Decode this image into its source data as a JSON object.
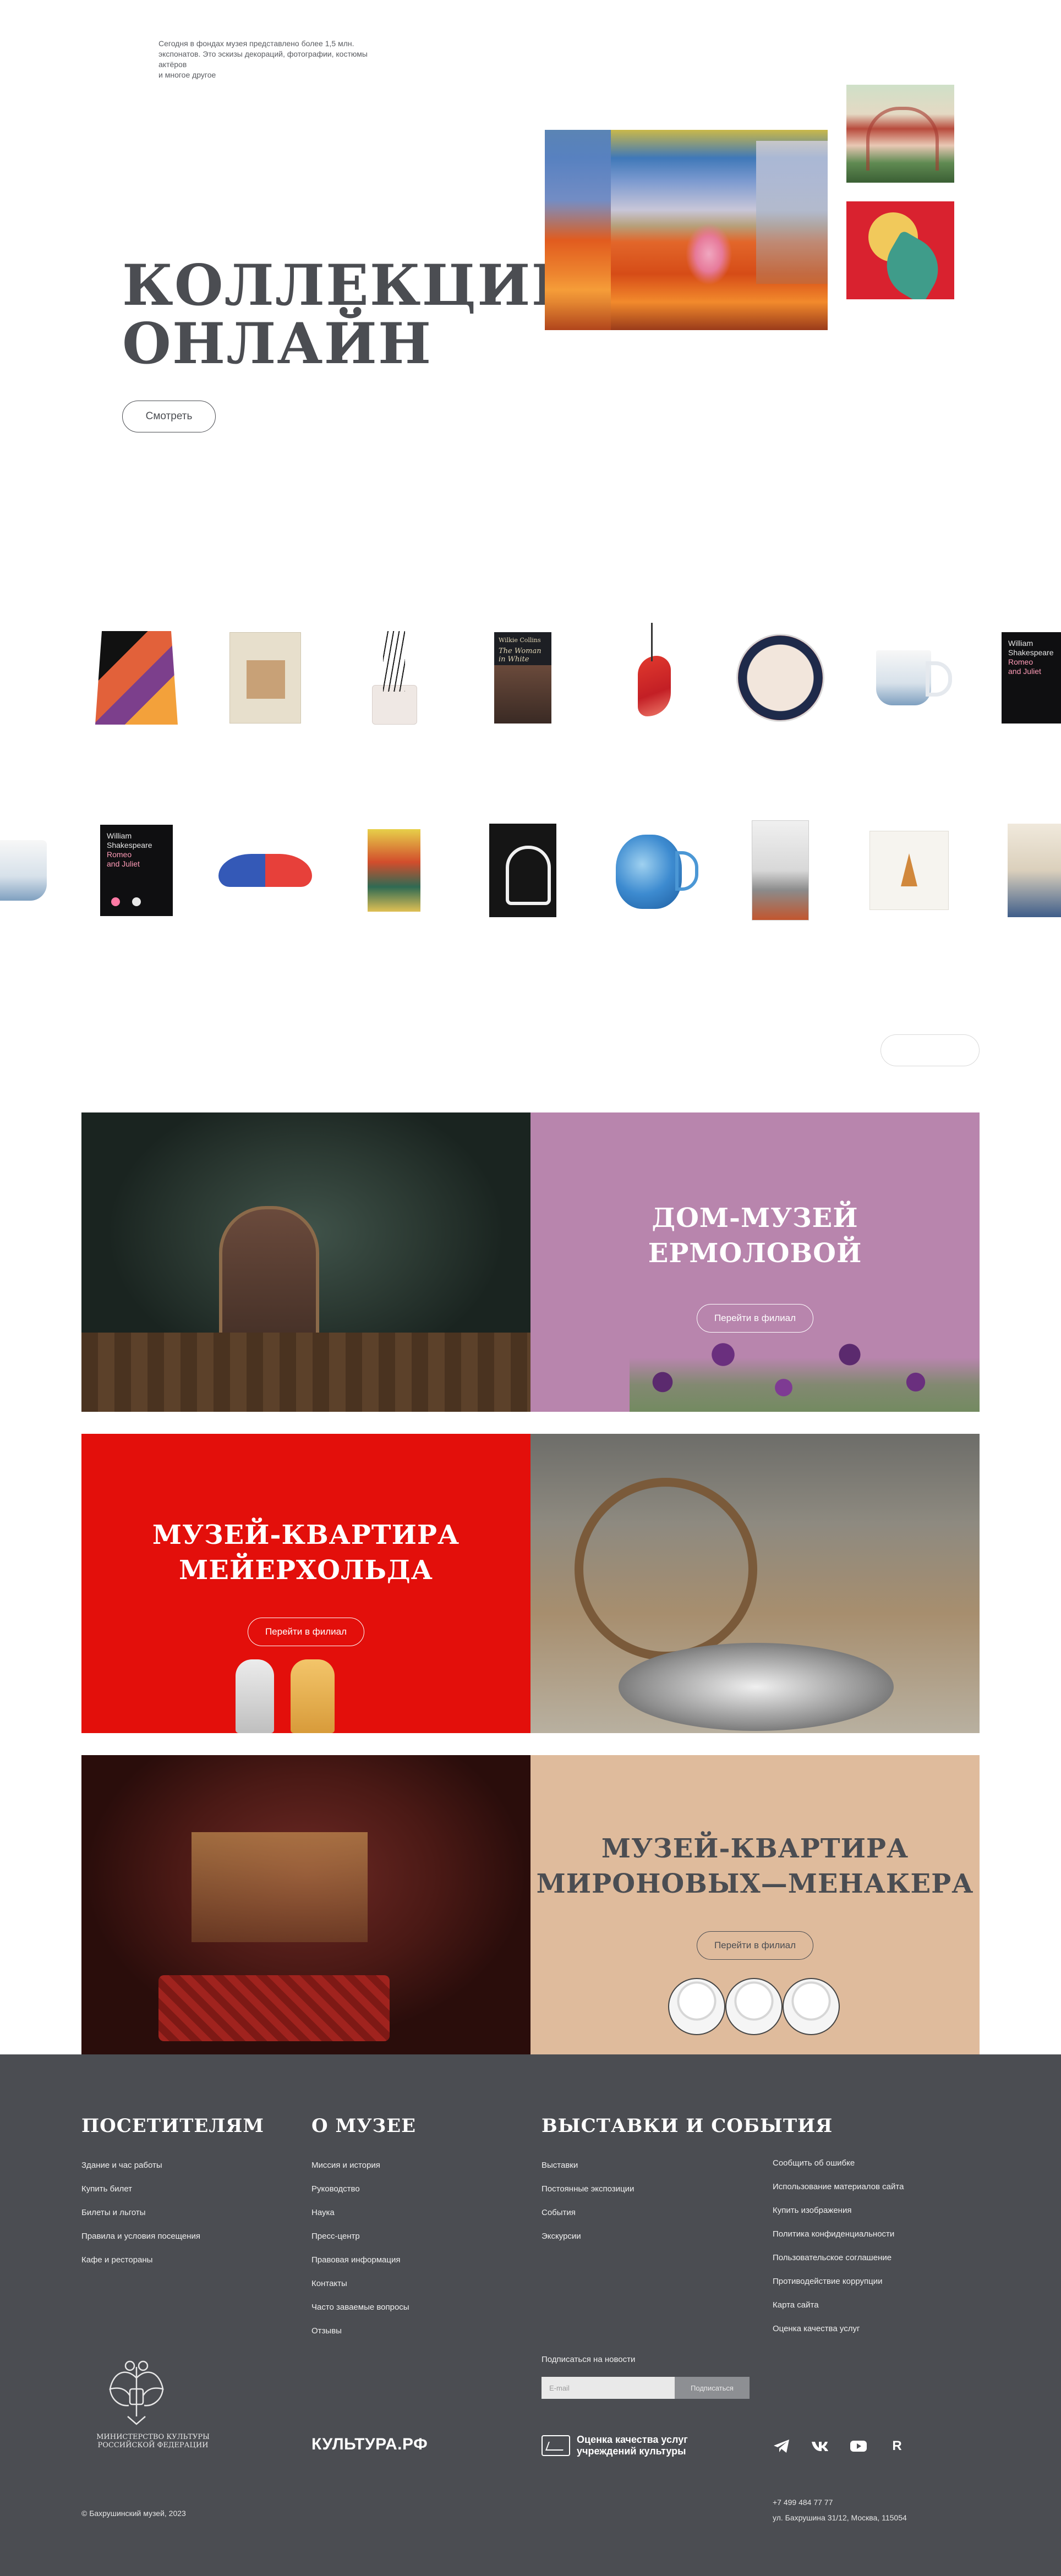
{
  "collections": {
    "note_lines": [
      "Сегодня в фондах музея представлено более 1,5 млн.",
      "экспонатов.  Это эскизы декораций, фотографии, костюмы",
      "актёров",
      "и многое другое"
    ],
    "title_lines": [
      "КОЛЛЕКЦИИ",
      "ОНЛАЙН"
    ],
    "button_label": "Смотреть"
  },
  "products": {
    "row1": [
      {
        "icon": "drawstring-bag"
      },
      {
        "icon": "book-beige"
      },
      {
        "icon": "reed-diffuser"
      },
      {
        "icon": "book-woman-in-white",
        "lines": [
          "Wilkie Collins",
          "The Woman in White"
        ]
      },
      {
        "icon": "glass-figurine"
      },
      {
        "icon": "decorative-plate"
      },
      {
        "icon": "porcelain-mug"
      },
      {
        "icon": "book-romeo-and-juliet-partial"
      }
    ],
    "row2": [
      {
        "icon": "porcelain-mug-partial"
      },
      {
        "icon": "book-romeo-and-juliet",
        "lines": [
          "William",
          "Shakespeare",
          "Romeo",
          "and Juliet"
        ]
      },
      {
        "icon": "glasses-case"
      },
      {
        "icon": "poster-circus-girl"
      },
      {
        "icon": "poster-hamlet"
      },
      {
        "icon": "blue-glass-jug"
      },
      {
        "icon": "book-gray"
      },
      {
        "icon": "notebook"
      },
      {
        "icon": "poster-partial"
      }
    ]
  },
  "branches": [
    {
      "title_lines": [
        "ДОМ-МУЗЕЙ",
        "ЕРМОЛОВОЙ"
      ],
      "button_label": "Перейти в филиал",
      "bg": "#b885ad",
      "text_color": "#ffffff"
    },
    {
      "title_lines": [
        "МУЗЕЙ-КВАРТИРА",
        "МЕЙЕРХОЛЬДА"
      ],
      "button_label": "Перейти в филиал",
      "bg": "#e30f0b",
      "text_color": "#ffffff"
    },
    {
      "title_lines": [
        "МУЗЕЙ-КВАРТИРА",
        "МИРОНОВЫХ—МЕНАКЕРА"
      ],
      "button_label": "Перейти в филиал",
      "bg": "#dfbb9c",
      "text_color": "#4b4d52"
    }
  ],
  "footer": {
    "visitors": {
      "heading": "ПОСЕТИТЕЛЯМ",
      "links": [
        "Здание и час работы",
        "Купить билет",
        "Билеты и льготы",
        "Правила и условия посещения",
        "Кафе и рестораны"
      ]
    },
    "about": {
      "heading": "О МУЗЕЕ",
      "links": [
        "Миссия и история",
        "Руководство",
        "Наука",
        "Пресс-центр",
        "Правовая информация",
        "Контакты",
        "Часто заваемые вопросы",
        "Отзывы"
      ]
    },
    "events": {
      "heading": "ВЫСТАВКИ И СОБЫТИЯ",
      "links": [
        "Выставки",
        "Постоянные экспозиции",
        "События",
        "Экскурсии"
      ]
    },
    "service_links": [
      "Сообщить об ошибке",
      "Использование материалов сайта",
      "Купить изображения",
      "Политика конфиденциальности",
      "Пользовательское соглашение",
      "Противодействие коррупции",
      "Карта сайта",
      "Оценка качества услуг"
    ],
    "subscribe": {
      "label": "Подписаться на новости",
      "placeholder": "E-mail",
      "button_label": "Подписаться"
    },
    "ministry_lines": [
      "МИНИСТЕРСТВО КУЛЬТУРЫ",
      "РОССИЙСКОЙ ФЕДЕРАЦИИ"
    ],
    "kultura_label": "КУЛЬТУРА.РФ",
    "quality_lines": [
      "Оценка качества услуг",
      "учреждений культуры"
    ],
    "socials": [
      "telegram-icon",
      "vk-icon",
      "youtube-icon",
      "rutube-icon"
    ],
    "rutube_label": "R",
    "copyright": "© Бахрушинский музей, 2023",
    "phone": "+7 499 484 77 77",
    "address": "ул. Бахрушина 31/12, Москва, 115054"
  },
  "colors": {
    "text": "#4b4d52",
    "footer_bg": "#4b4d52",
    "ermolova": "#b885ad",
    "meyerhold": "#e30f0b",
    "mironov": "#dfbb9c"
  }
}
